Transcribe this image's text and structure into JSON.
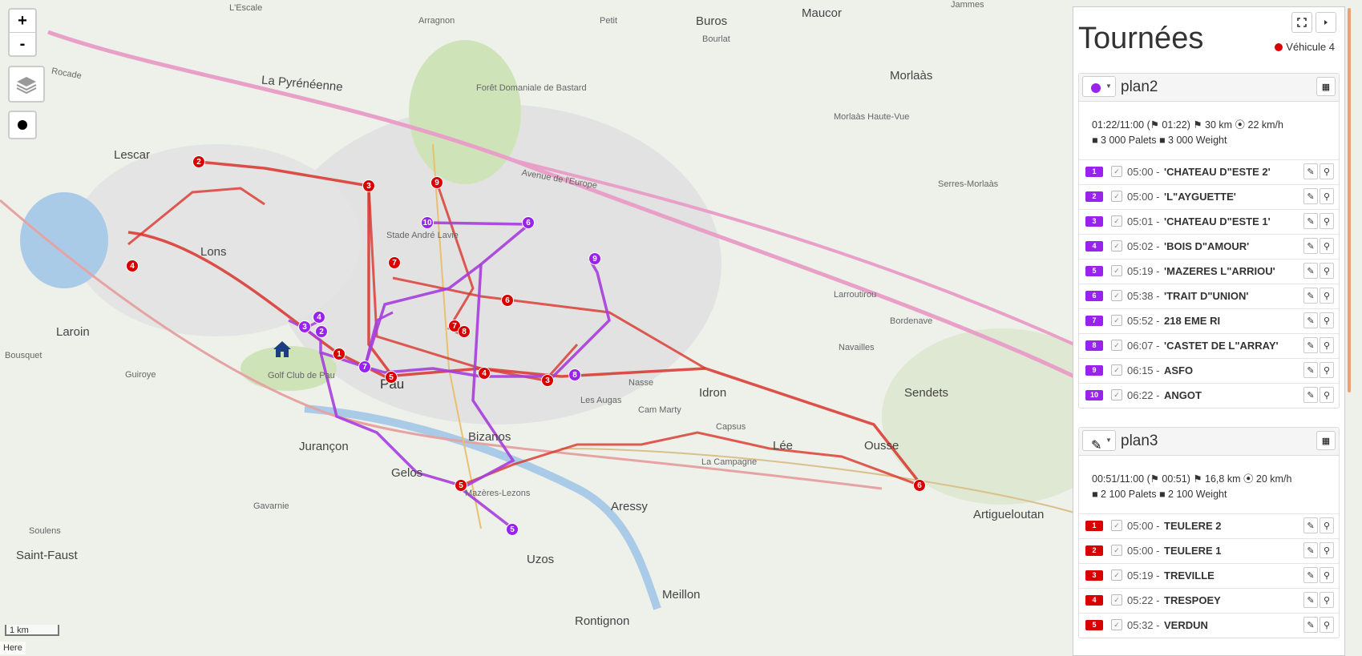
{
  "map": {
    "zoom_in": "+",
    "zoom_out": "-",
    "scale_label": "1 km",
    "attribution": "Here",
    "place_labels": [
      {
        "text": "L'Escale",
        "cls": "small"
      },
      {
        "text": "Arragnon",
        "cls": "small"
      },
      {
        "text": "Petit",
        "cls": "small"
      },
      {
        "text": "Buros",
        "cls": "town"
      },
      {
        "text": "Bourlat",
        "cls": "small"
      },
      {
        "text": "Maucor",
        "cls": "town"
      },
      {
        "text": "Jammes",
        "cls": "small"
      },
      {
        "text": "Lescar",
        "cls": "town"
      },
      {
        "text": "Lons",
        "cls": "town"
      },
      {
        "text": "Pau",
        "cls": "city"
      },
      {
        "text": "Jurançon",
        "cls": "town"
      },
      {
        "text": "Gelos",
        "cls": "town"
      },
      {
        "text": "Bizanos",
        "cls": "town"
      },
      {
        "text": "Idron",
        "cls": "town"
      },
      {
        "text": "Lée",
        "cls": "town"
      },
      {
        "text": "Ousse",
        "cls": "town"
      },
      {
        "text": "Sendets",
        "cls": "town"
      },
      {
        "text": "Morlaàs",
        "cls": "town"
      },
      {
        "text": "Serres-Morlaàs",
        "cls": "small"
      },
      {
        "text": "Aressy",
        "cls": "town"
      },
      {
        "text": "Meillon",
        "cls": "town"
      },
      {
        "text": "Rontignon",
        "cls": "town"
      },
      {
        "text": "Uzos",
        "cls": "town"
      },
      {
        "text": "Mazères-Lezons",
        "cls": "small"
      },
      {
        "text": "Artigueloutan",
        "cls": "town"
      },
      {
        "text": "Laroin",
        "cls": "town"
      },
      {
        "text": "Saint-Faust",
        "cls": "town"
      },
      {
        "text": "Forêt Domaniale de Bastard",
        "cls": "small"
      },
      {
        "text": "Avenue de l'Europe",
        "cls": "small"
      },
      {
        "text": "La Pyrénéenne",
        "cls": "town"
      },
      {
        "text": "Rocade",
        "cls": "small"
      },
      {
        "text": "Morlaàs Haute-Vue",
        "cls": "small"
      },
      {
        "text": "Golf Club de Pau",
        "cls": "small"
      },
      {
        "text": "Stade André Lavie",
        "cls": "small"
      },
      {
        "text": "Larroutirou",
        "cls": "small"
      },
      {
        "text": "Bordenave",
        "cls": "small"
      },
      {
        "text": "Navailles",
        "cls": "small"
      },
      {
        "text": "Capsus",
        "cls": "small"
      },
      {
        "text": "La Campagne",
        "cls": "small"
      },
      {
        "text": "Nasse",
        "cls": "small"
      },
      {
        "text": "Les Augas",
        "cls": "small"
      },
      {
        "text": "Cam Marty",
        "cls": "small"
      },
      {
        "text": "Soulens",
        "cls": "small"
      },
      {
        "text": "Gavarnie",
        "cls": "small"
      },
      {
        "text": "Bousquet",
        "cls": "small"
      },
      {
        "text": "Guiroye",
        "cls": "small"
      },
      {
        "text": "Idron",
        "cls": "small"
      }
    ]
  },
  "panel": {
    "title": "Tournées",
    "vehicle": "Véhicule 4",
    "vehicle_color": "#d90000",
    "plans": [
      {
        "name": "plan2",
        "color": "#9922ee",
        "stats_line1": "01:22/11:00 (⚑ 01:22) ⚑ 30 km ⦿ 22 km/h",
        "stats_line2": "■ 3 000 Palets ■ 3 000 Weight",
        "stops": [
          {
            "num": "1",
            "time": "05:00 -",
            "name": "'CHATEAU D\"ESTE 2'"
          },
          {
            "num": "2",
            "time": "05:00 -",
            "name": "'L\"AYGUETTE'"
          },
          {
            "num": "3",
            "time": "05:01 -",
            "name": "'CHATEAU D\"ESTE 1'"
          },
          {
            "num": "4",
            "time": "05:02 -",
            "name": "'BOIS D\"AMOUR'"
          },
          {
            "num": "5",
            "time": "05:19 -",
            "name": "'MAZERES L\"ARRIOU'"
          },
          {
            "num": "6",
            "time": "05:38 -",
            "name": "'TRAIT D\"UNION'"
          },
          {
            "num": "7",
            "time": "05:52 -",
            "name": "218 EME RI"
          },
          {
            "num": "8",
            "time": "06:07 -",
            "name": "'CASTET DE L\"ARRAY'"
          },
          {
            "num": "9",
            "time": "06:15 -",
            "name": "ASFO"
          },
          {
            "num": "10",
            "time": "06:22 -",
            "name": "ANGOT"
          }
        ]
      },
      {
        "name": "plan3",
        "color": "#d90000",
        "stats_line1": "00:51/11:00 (⚑ 00:51) ⚑ 16,8 km ⦿ 20 km/h",
        "stats_line2": "■ 2 100 Palets ■ 2 100 Weight",
        "stops": [
          {
            "num": "1",
            "time": "05:00 -",
            "name": "TEULERE 2"
          },
          {
            "num": "2",
            "time": "05:00 -",
            "name": "TEULERE 1"
          },
          {
            "num": "3",
            "time": "05:19 -",
            "name": "TREVILLE"
          },
          {
            "num": "4",
            "time": "05:22 -",
            "name": "TRESPOEY"
          },
          {
            "num": "5",
            "time": "05:32 -",
            "name": "VERDUN"
          }
        ]
      }
    ]
  },
  "markers": {
    "red": [
      "1",
      "2",
      "3",
      "4",
      "5",
      "6",
      "7",
      "8",
      "9",
      "2",
      "3",
      "4",
      "5",
      "6"
    ],
    "purple": [
      "1",
      "2",
      "3",
      "4",
      "5",
      "6",
      "7",
      "8",
      "9",
      "10"
    ]
  }
}
